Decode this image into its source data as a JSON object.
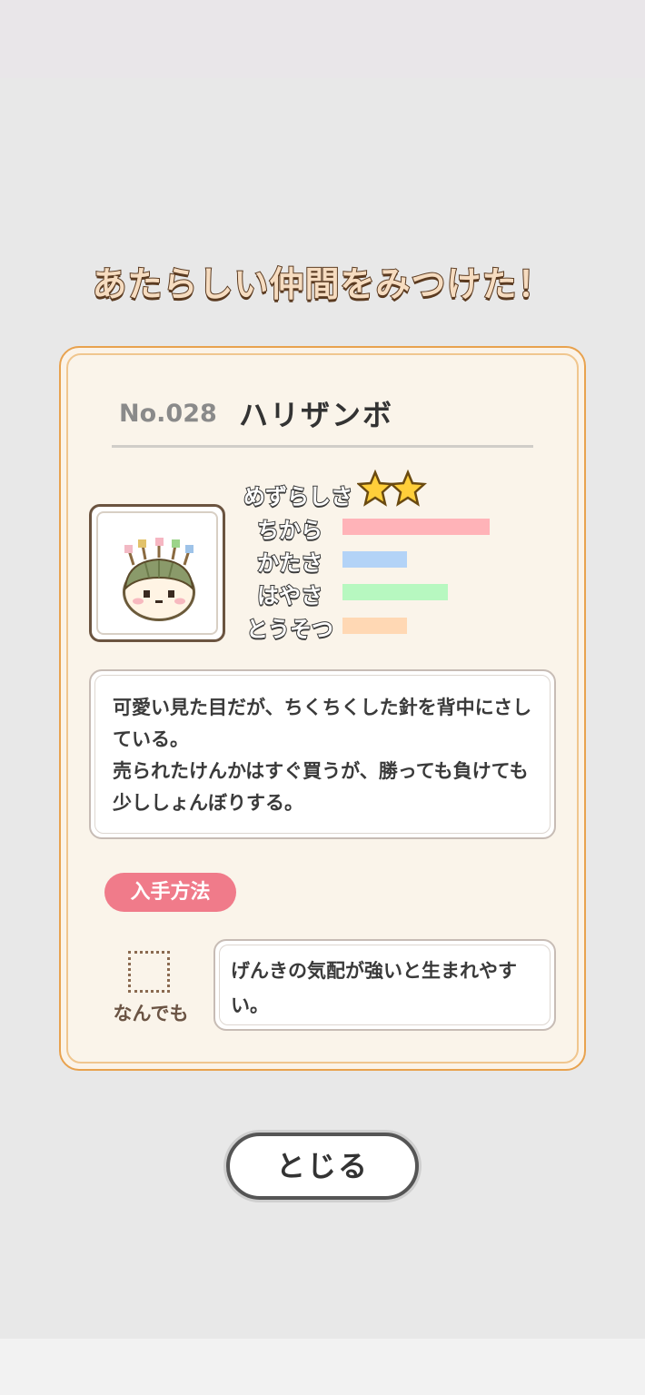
{
  "headline": "あたらしい仲間をみつけた！",
  "card": {
    "number": "No.028",
    "name": "ハリザンボ",
    "character_icon": "hedgehog-pincushion-character",
    "rarity_label": "めずらしさ",
    "rarity_stars": 2,
    "stats": [
      {
        "label": "ちから",
        "level": 0.8,
        "color": "#ffb3b8"
      },
      {
        "label": "かたさ",
        "level": 0.35,
        "color": "#b3d3f7"
      },
      {
        "label": "はやさ",
        "level": 0.57,
        "color": "#b7f8c0"
      },
      {
        "label": "とうそつ",
        "level": 0.35,
        "color": "#ffd8b4"
      }
    ],
    "description": "可愛い見た目だが、ちくちくした針を背中にさしている。\n売られたけんかはすぐ買うが、勝っても負けても少ししょんぼりする。",
    "method_badge": "入手方法",
    "method_icon": "dotted-square-icon",
    "method_label": "なんでも",
    "condition": "げんきの気配が強いと生まれやすい。"
  },
  "close_button": "とじる"
}
